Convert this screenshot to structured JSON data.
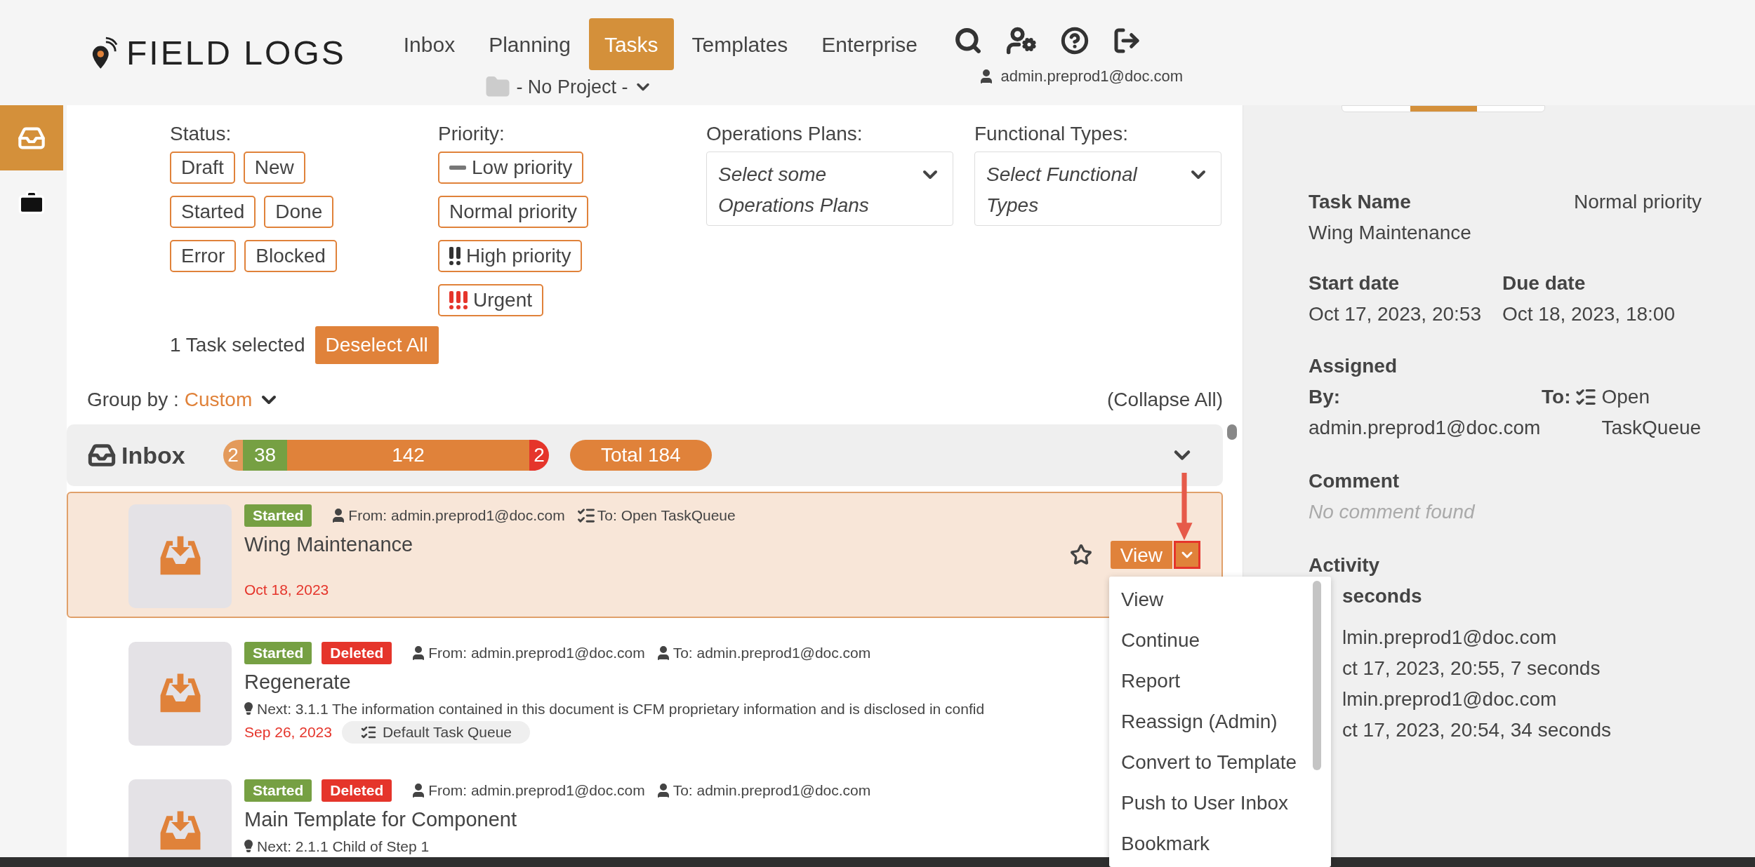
{
  "header": {
    "logo": "FIELD LOGS",
    "nav": [
      {
        "label": "Inbox",
        "selected": false
      },
      {
        "label": "Planning",
        "selected": false
      },
      {
        "label": "Tasks",
        "selected": true
      },
      {
        "label": "Templates",
        "selected": false
      },
      {
        "label": "Enterprise",
        "selected": false
      }
    ],
    "project": "- No Project -",
    "user": "admin.preprod1@doc.com"
  },
  "sidebar": [
    {
      "selected": true
    },
    {
      "selected": false
    }
  ],
  "filters": {
    "status_label": "Status:",
    "status": [
      [
        "Draft",
        "New"
      ],
      [
        "Started",
        "Done"
      ],
      [
        "Error",
        "Blocked"
      ]
    ],
    "priority_label": "Priority:",
    "priority": [
      {
        "label": "Low priority",
        "kind": "low"
      },
      {
        "label": "Normal priority",
        "kind": "normal"
      },
      {
        "label": "High priority",
        "kind": "high"
      },
      {
        "label": "Urgent",
        "kind": "urgent"
      }
    ],
    "ops_label": "Operations Plans:",
    "ops_placeholder": "Select some Operations Plans",
    "types_label": "Functional Types:",
    "types_placeholder": "Select Functional Types"
  },
  "selection": {
    "text": "1 Task selected",
    "button": "Deselect All"
  },
  "group_by": {
    "label": "Group by :",
    "value": "Custom",
    "collapse": "(Collapse All)"
  },
  "group": {
    "title": "Inbox",
    "counts": [
      {
        "value": "2",
        "color": "#e39a5b"
      },
      {
        "value": "38",
        "color": "#76a043"
      },
      {
        "value": "142",
        "color": "#e0823a"
      },
      {
        "value": "2",
        "color": "#e5352b"
      }
    ],
    "total": "Total 184"
  },
  "tasks": [
    {
      "badges": [
        {
          "label": "Started",
          "color": "#76a043"
        }
      ],
      "from": "From: admin.preprod1@doc.com",
      "to": "To: Open TaskQueue",
      "kind": "queue",
      "title": "Wing Maintenance",
      "date": "Oct 18, 2023",
      "selected": true,
      "action": "View"
    },
    {
      "badges": [
        {
          "label": "Started",
          "color": "#76a043"
        },
        {
          "label": "Deleted",
          "color": "#e5352b"
        }
      ],
      "from": "From: admin.preprod1@doc.com",
      "to": "To: admin.preprod1@doc.com",
      "kind": "user",
      "title": "Regenerate",
      "next": "Next: 3.1.1 The information contained in this document is CFM proprietary information and is disclosed in confid",
      "date": "Sep 26, 2023",
      "queue": "Default Task Queue",
      "selected": false
    },
    {
      "badges": [
        {
          "label": "Started",
          "color": "#76a043"
        },
        {
          "label": "Deleted",
          "color": "#e5352b"
        }
      ],
      "from": "From: admin.preprod1@doc.com",
      "to": "To: admin.preprod1@doc.com",
      "kind": "user",
      "title": "Main Template for Component",
      "next": "Next: 2.1.1 Child of Step 1",
      "selected": false
    }
  ],
  "menu": [
    "View",
    "Continue",
    "Report",
    "Reassign (Admin)",
    "Convert to Template",
    "Push to User Inbox",
    "Bookmark"
  ],
  "details": {
    "task_name_label": "Task Name",
    "priority": "Normal priority",
    "task_name": "Wing Maintenance",
    "start_label": "Start date",
    "start": "Oct 17, 2023, 20:53",
    "due_label": "Due date",
    "due": "Oct 18, 2023, 18:00",
    "assigned_label": "Assigned",
    "by_label": "By:",
    "by": "admin.preprod1@doc.com",
    "to_label": "To:",
    "to": "Open TaskQueue",
    "comment_label": "Comment",
    "comment": "No comment found",
    "activity_label": "Activity",
    "activity_head": "seconds",
    "activity": [
      "lmin.preprod1@doc.com",
      "ct 17, 2023, 20:55, 7 seconds",
      "lmin.preprod1@doc.com",
      "ct 17, 2023, 20:54, 34 seconds"
    ]
  }
}
